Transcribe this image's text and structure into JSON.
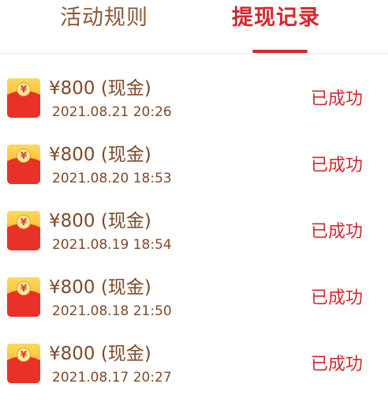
{
  "tabs": {
    "rules_label": "活动规则",
    "records_label": "提现记录"
  },
  "records": [
    {
      "amount": "¥800 (现金)",
      "time": "2021.08.21 20:26",
      "status": "已成功"
    },
    {
      "amount": "¥800 (现金)",
      "time": "2021.08.20 18:53",
      "status": "已成功"
    },
    {
      "amount": "¥800 (现金)",
      "time": "2021.08.19 18:54",
      "status": "已成功"
    },
    {
      "amount": "¥800 (现金)",
      "time": "2021.08.18 21:50",
      "status": "已成功"
    },
    {
      "amount": "¥800 (现金)",
      "time": "2021.08.17 20:27",
      "status": "已成功"
    }
  ],
  "icons": {
    "envelope": "red-envelope-icon",
    "coin_glyph": "¥"
  },
  "colors": {
    "accent": "#d4282d",
    "text_brown": "#7f4a2a"
  }
}
